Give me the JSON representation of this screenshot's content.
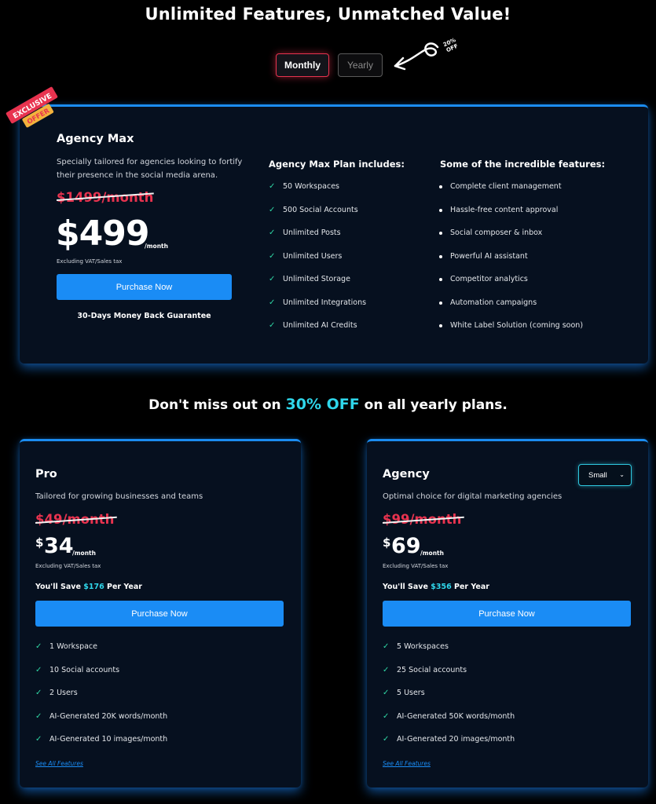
{
  "header": {
    "title": "Unlimited Features, Unmatched Value!",
    "toggle": {
      "monthly": "Monthly",
      "yearly": "Yearly",
      "selected": "Monthly"
    },
    "discount_tag": {
      "line1": "20%",
      "line2": "OFF"
    }
  },
  "agency_max": {
    "badge": {
      "line1": "EXCLUSIVE",
      "line2": "OFFER"
    },
    "name": "Agency Max",
    "description": "Specially tailored for agencies looking to fortify their presence in the social media arena.",
    "old_price": "$1499/month",
    "price": "$499",
    "per_month": "/month",
    "vat_note": "Excluding VAT/Sales tax",
    "purchase_label": "Purchase Now",
    "guarantee": "30-Days Money Back Guarantee",
    "includes_heading": "Agency Max Plan includes:",
    "includes": [
      "50 Workspaces",
      "500 Social Accounts",
      "Unlimited Posts",
      "Unlimited Users",
      "Unlimited Storage",
      "Unlimited Integrations",
      "Unlimited AI Credits"
    ],
    "features_heading": "Some of the incredible features:",
    "features": [
      "Complete client management",
      "Hassle-free content approval",
      "Social composer & inbox",
      "Powerful AI assistant",
      "Competitor analytics",
      "Automation campaigns",
      "White Label Solution (coming soon)"
    ]
  },
  "promo": {
    "prefix": "Don't miss out on ",
    "highlight": "30% OFF",
    "suffix": " on all yearly plans."
  },
  "plans": [
    {
      "name": "Pro",
      "description": "Tailored for growing businesses and teams",
      "old_price": "$49/month",
      "currency": "$",
      "price": "34",
      "per_month": "/month",
      "vat_note": "Excluding VAT/Sales tax",
      "save_prefix": "You'll Save ",
      "save_amount": "$176",
      "save_suffix": " Per Year",
      "purchase_label": "Purchase Now",
      "features": [
        "1 Workspace",
        "10 Social accounts",
        "2 Users",
        "AI-Generated 20K words/month",
        "AI-Generated 10 images/month"
      ],
      "see_all": "See All Features"
    },
    {
      "name": "Agency",
      "size_select": "Small",
      "description": "Optimal choice for digital marketing agencies",
      "old_price": "$99/month",
      "currency": "$",
      "price": "69",
      "per_month": "/month",
      "vat_note": "Excluding VAT/Sales tax",
      "save_prefix": "You'll Save ",
      "save_amount": "$356",
      "save_suffix": " Per Year",
      "purchase_label": "Purchase Now",
      "features": [
        "5 Workspaces",
        "25 Social accounts",
        "5 Users",
        "AI-Generated 50K words/month",
        "AI-Generated 20 images/month"
      ],
      "see_all": "See All Features"
    }
  ],
  "colors": {
    "background": "#000000",
    "card": "#06101f",
    "accent_blue": "#1a8cf5",
    "accent_red": "#e8334f",
    "accent_cyan": "#2fd6ea",
    "check_green": "#2fd6a4"
  },
  "icons": {
    "check": "check-icon",
    "bullet": "bullet-icon",
    "arrow": "curly-arrow-icon",
    "chevron": "chevron-down-icon"
  }
}
